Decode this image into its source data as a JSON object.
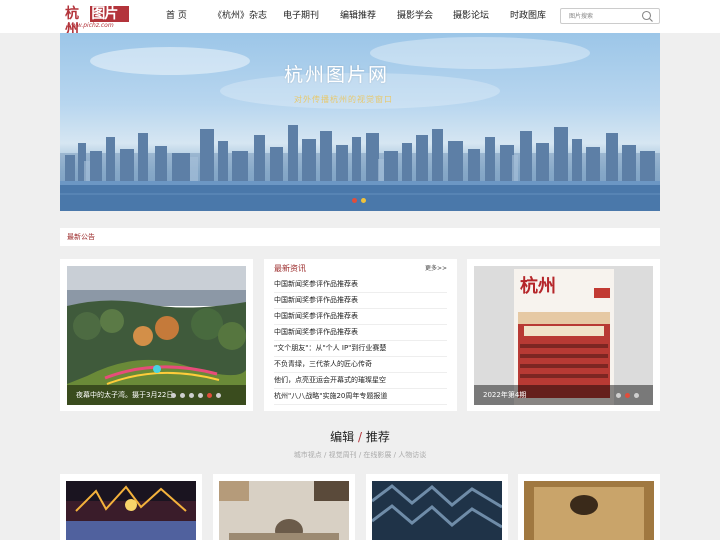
{
  "header": {
    "logo_text": "杭州",
    "logo_box": "图片网",
    "logo_url": "www.pichz.com",
    "nav": [
      "首 页",
      "《杭州》杂志",
      "电子期刊",
      "编辑推荐",
      "摄影学会",
      "摄影论坛",
      "时政图库"
    ],
    "search_placeholder": "图片搜索"
  },
  "banner": {
    "title": "杭州图片网",
    "subtitle": "对外传播杭州的视觉窗口",
    "dots": [
      "#e14d3b",
      "#f0c23b"
    ]
  },
  "notice": {
    "label": "最新公告"
  },
  "left_photo": {
    "caption": "夜幕中的太子湾。摄于3月22日",
    "dot_count": 6,
    "active_dot": 4
  },
  "news": {
    "title": "最新资讯",
    "more": "更多>>",
    "items": [
      "中国新闻奖参评作品推荐表",
      "中国新闻奖参评作品推荐表",
      "中国新闻奖参评作品推荐表",
      "中国新闻奖参评作品推荐表",
      "\"文个朋友\"：从\"个人 IP\"到行业赛楚",
      "不负青绿，三代茶人的匠心传奇",
      "他们，点亮亚运会开幕式的璀璨星空",
      "杭州\"八八战略\"实施20周年专题报道"
    ]
  },
  "magazine": {
    "cover_title": "杭州",
    "caption": "2022年第4期",
    "dot_count": 3,
    "active_dot": 1
  },
  "section": {
    "title_a": "编辑",
    "slash": " / ",
    "title_b": "推荐",
    "subtitle": "城市视点 / 视觉周刊 / 在线影展 / 人物访谈"
  }
}
